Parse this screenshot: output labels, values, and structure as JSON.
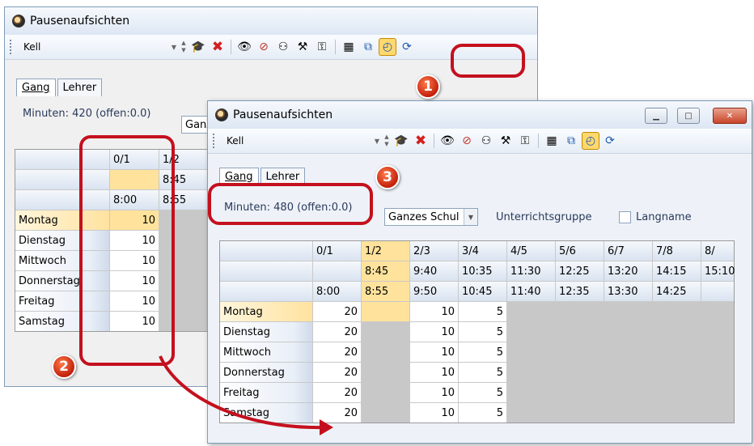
{
  "back_window": {
    "title": "Pausenaufsichten",
    "toolbar_value": "Kell",
    "tabs": [
      "Gang",
      "Lehrer"
    ],
    "minutes_info": "Minuten: 420 (offen:0.0)",
    "combo_fragment": "Ganz",
    "columns": [
      "0/1",
      "1/2"
    ],
    "row2": [
      "",
      "8:45"
    ],
    "row3": [
      "8:00",
      "8:55"
    ],
    "days": [
      "Montag",
      "Dienstag",
      "Mittwoch",
      "Donnerstag",
      "Freitag",
      "Samstag"
    ],
    "values": [
      "10",
      "10",
      "10",
      "10",
      "10",
      "10"
    ]
  },
  "front_window": {
    "title": "Pausenaufsichten",
    "toolbar_value": "Kell",
    "tabs": [
      "Gang",
      "Lehrer"
    ],
    "minutes_info": "Minuten: 480 (offen:0.0)",
    "group_combo": "Ganzes Schul",
    "group_label": "Unterrichtsgruppe",
    "langname_label": "Langname",
    "columns": [
      "0/1",
      "1/2",
      "2/3",
      "3/4",
      "4/5",
      "5/6",
      "6/7",
      "7/8",
      "8/"
    ],
    "row2": [
      "",
      "8:45",
      "9:40",
      "10:35",
      "11:30",
      "12:25",
      "13:20",
      "14:15",
      "15:10"
    ],
    "row3": [
      "8:00",
      "8:55",
      "9:50",
      "10:45",
      "11:40",
      "12:35",
      "13:30",
      "14:25",
      ""
    ],
    "days": [
      "Montag",
      "Dienstag",
      "Mittwoch",
      "Donnerstag",
      "Freitag",
      "Samstag"
    ],
    "col0_values": [
      "20",
      "20",
      "20",
      "20",
      "20",
      "20"
    ],
    "col2_values": [
      "10",
      "10",
      "10",
      "10",
      "10",
      "10"
    ],
    "col3_values": [
      "5",
      "5",
      "5",
      "5",
      "5",
      "5"
    ]
  },
  "markers": [
    "1",
    "2",
    "3"
  ],
  "icons": {
    "teacher": "graduation-cap-icon",
    "delete": "red-x-icon",
    "view": "eye-icon",
    "hide": "eye-crossed-icon",
    "clock": "clock-icon"
  },
  "colors": {
    "highlight": "#c4101e",
    "selected_cell": "#ffe39c",
    "blocked_cell": "#c8c8c8"
  }
}
